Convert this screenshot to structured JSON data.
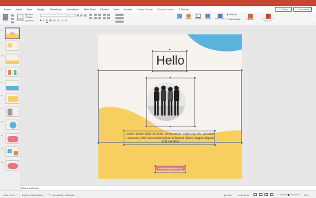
{
  "ribbon_tabs": [
    "Home",
    "Insert",
    "Draw",
    "Design",
    "Transitions",
    "Animations",
    "Slide Show",
    "Review",
    "View",
    "Acrobat",
    "Shape Format",
    "Picture Format",
    "Tell me"
  ],
  "share": {
    "label": "Share"
  },
  "comments": {
    "label": "Comments"
  },
  "ribbon": {
    "paste": "Paste",
    "new_slide": "New Slide",
    "layout": "Layout",
    "reset": "Reset",
    "section": "Section",
    "font_size": "",
    "picture": "Picture",
    "shapes": "Shapes",
    "text_box": "Text Box",
    "arrange": "Arrange",
    "quick_styles": "Quick Styles",
    "shape_fill": "Shape Fill",
    "shape_outline": "Shape Outline",
    "designer": "Designer",
    "create_share": "Create and Share Adobe PDF"
  },
  "slides": [
    "1",
    "2",
    "3",
    "4",
    "5",
    "6",
    "7",
    "8",
    "9",
    "10",
    "11"
  ],
  "slide": {
    "title": "Hello",
    "body": "Lorem ipsum dolor sit amet, consectetuer adipiscing elit, sed diam nonummy nibh euismod tincidunt ut laoreet dolore magna aliquam erat volutpat.",
    "link": "www.reallygreatsite.com"
  },
  "notes_placeholder": "Click to add notes",
  "status": {
    "slide_of": "Slide 1 of 11",
    "language": "English (United States)",
    "accessibility": "Accessibility: Investigate",
    "notes": "Notes",
    "comments": "Comments",
    "zoom": "65%"
  },
  "colors": {
    "titlebar": "#c6472b",
    "accent": "#c6472b",
    "yellow": "#f7cf61",
    "blue": "#5ab3dd",
    "pink": "#e97583"
  }
}
